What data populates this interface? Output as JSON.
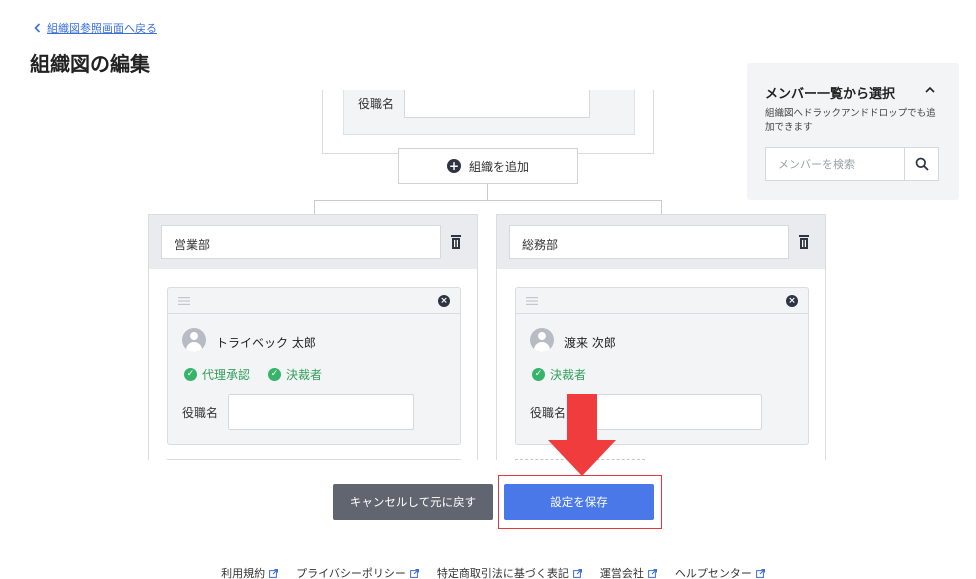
{
  "nav": {
    "back_label": "組織図参照画面へ戻る"
  },
  "page": {
    "title": "組織図の編集"
  },
  "top_box": {
    "role_label": "役職名",
    "role_value": ""
  },
  "add_org_label": "組織を追加",
  "departments": [
    {
      "name": "営業部",
      "member": {
        "name": "トライベック 太郎",
        "badges": [
          "代理承認",
          "決裁者"
        ],
        "role_label": "役職名",
        "role_value": ""
      }
    },
    {
      "name": "総務部",
      "member": {
        "name": "渡来 次郎",
        "badges": [
          "決裁者"
        ],
        "role_label": "役職名",
        "role_value": ""
      }
    }
  ],
  "panel": {
    "title": "メンバー一覧から選択",
    "description": "組織図へドラックアンドドロップでも追加できます",
    "search_placeholder": "メンバーを検索"
  },
  "actions": {
    "cancel_label": "キャンセルして元に戻す",
    "save_label": "設定を保存"
  },
  "footer": {
    "links": [
      "利用規約",
      "プライバシーポリシー",
      "特定商取引法に基づく表記",
      "運営会社",
      "ヘルプセンター"
    ]
  },
  "colors": {
    "accent": "#4a78e8",
    "success": "#37b36a",
    "highlight": "#e0383e",
    "arrow": "#f03c3c"
  }
}
